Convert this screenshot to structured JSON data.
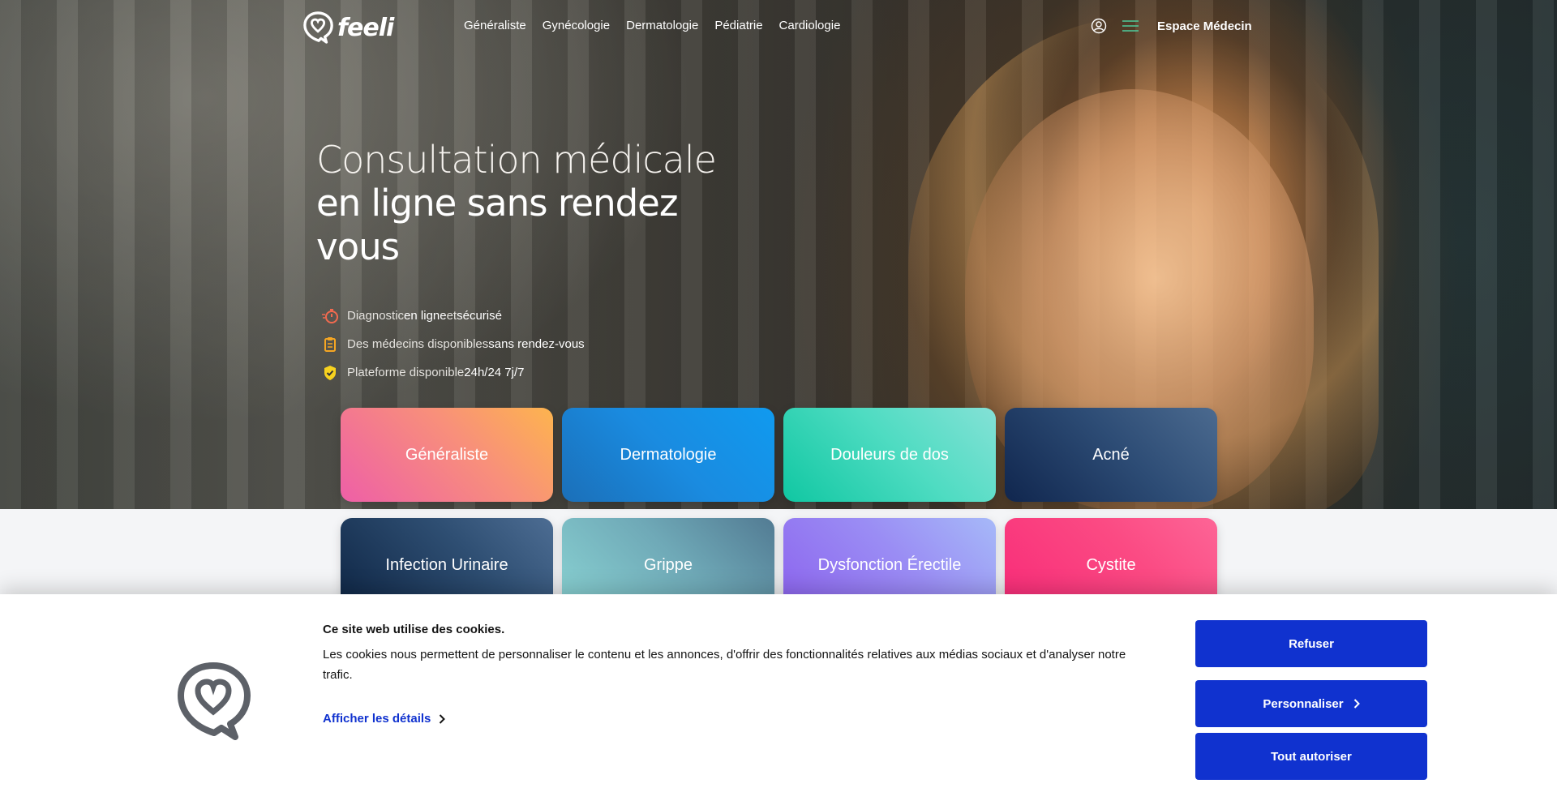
{
  "brand": {
    "name": "feeli"
  },
  "nav": {
    "links": [
      "Généraliste",
      "Gynécologie",
      "Dermatologie",
      "Pédiatrie",
      "Cardiologie"
    ],
    "espace_label": "Espace Médecin",
    "icons": [
      "user-icon",
      "menu-icon"
    ]
  },
  "hero": {
    "title_line1": "Consultation médicale",
    "title_line2": "en ligne sans rendez",
    "title_line3": "vous",
    "features": [
      {
        "icon": "stopwatch-icon",
        "pre": "Diagnostic ",
        "b1": "en ligne",
        "mid": " et ",
        "b2": "sécurisé"
      },
      {
        "icon": "clipboard-icon",
        "pre": "Des médecins disponibles ",
        "b1": "sans rendez-vous",
        "mid": "",
        "b2": ""
      },
      {
        "icon": "shield-check-icon",
        "pre": "Plateforme disponible ",
        "b1": "24h/24 7j/7",
        "mid": "",
        "b2": ""
      }
    ]
  },
  "tiles": [
    "Généraliste",
    "Dermatologie",
    "Douleurs de dos",
    "Acné",
    "Infection Urinaire",
    "Grippe",
    "Dysfonction Érectile",
    "Cystite"
  ],
  "cookie": {
    "title": "Ce site web utilise des cookies.",
    "text": "Les cookies nous permettent de personnaliser le contenu et les annonces, d'offrir des fonctionnalités relatives aux médias sociaux et d'analyser notre trafic.",
    "details_label": "Afficher les détails",
    "refuse_label": "Refuser",
    "customize_label": "Personnaliser",
    "accept_all_label": "Tout autoriser"
  },
  "colors": {
    "primary_button": "#1032cf",
    "accent_green": "#4ecb9c"
  }
}
